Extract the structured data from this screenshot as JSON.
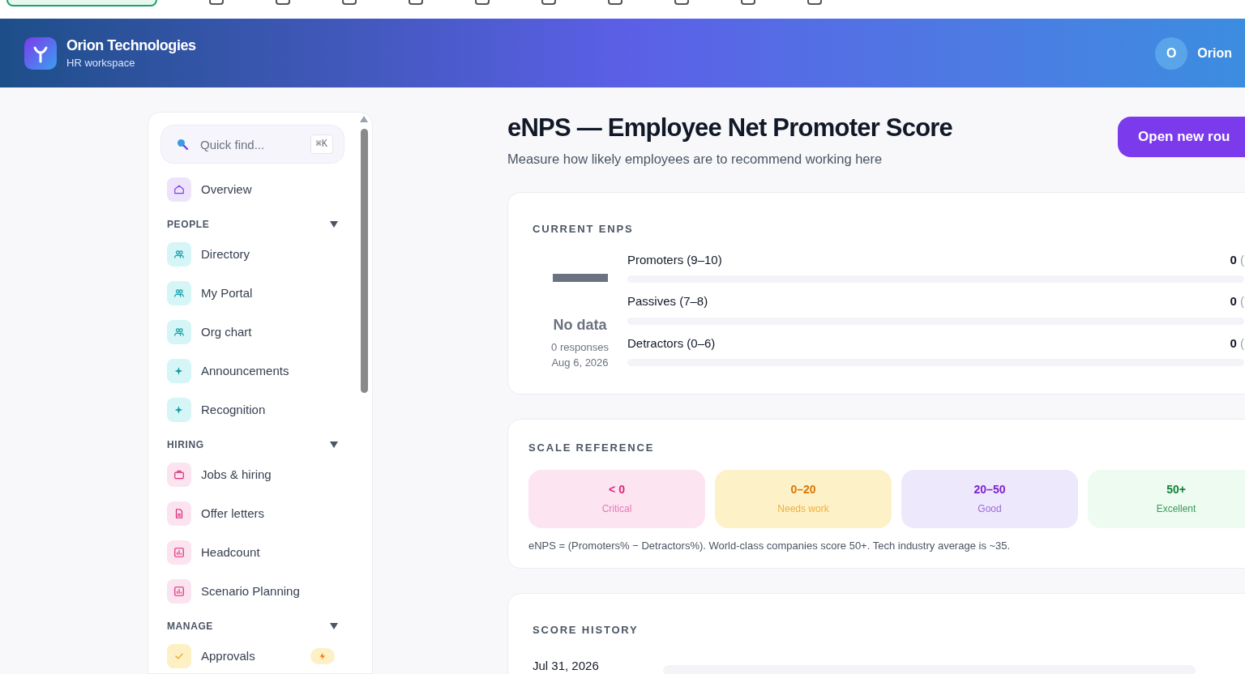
{
  "header": {
    "org": "Orion Technologies",
    "subtitle": "HR workspace",
    "avatar": "O",
    "user": "Orion"
  },
  "sidebar": {
    "search": {
      "placeholder": "Quick find...",
      "shortcut": "⌘K"
    },
    "top_items": [
      {
        "label": "Overview",
        "kind": "home",
        "color": "#ede4fb"
      }
    ],
    "sections": [
      {
        "title": "PEOPLE",
        "expanded": true,
        "items": [
          {
            "label": "Directory",
            "kind": "users",
            "color": "#d5f5f6"
          },
          {
            "label": "My Portal",
            "kind": "users",
            "color": "#d5f5f6"
          },
          {
            "label": "Org chart",
            "kind": "users",
            "color": "#d5f5f6"
          },
          {
            "label": "Announcements",
            "kind": "sparkle",
            "color": "#d5f5f6"
          },
          {
            "label": "Recognition",
            "kind": "sparkle",
            "color": "#d5f5f6"
          }
        ]
      },
      {
        "title": "HIRING",
        "expanded": true,
        "items": [
          {
            "label": "Jobs & hiring",
            "kind": "briefcase",
            "color": "#fbe3ef"
          },
          {
            "label": "Offer letters",
            "kind": "file",
            "color": "#fbe3ef"
          },
          {
            "label": "Headcount",
            "kind": "chart",
            "color": "#fbe3ef"
          },
          {
            "label": "Scenario Planning",
            "kind": "chart",
            "color": "#fbe3ef"
          }
        ]
      },
      {
        "title": "MANAGE",
        "expanded": true,
        "items": [
          {
            "label": "Approvals",
            "kind": "check",
            "color": "#fdf0c4",
            "alert": true
          }
        ]
      }
    ]
  },
  "page": {
    "title": "eNPS — Employee Net Promoter Score",
    "subtitle": "Measure how likely employees are to recommend working here",
    "action": "Open new rou"
  },
  "current": {
    "heading": "CURRENT ENPS",
    "score": "No data",
    "responses": "0 responses",
    "date": "Aug 6, 2026",
    "groups": [
      {
        "label": "Promoters (9–10)",
        "count": "0",
        "share": "(",
        "level": 0
      },
      {
        "label": "Passives (7–8)",
        "count": "0",
        "share": "(",
        "level": 0
      },
      {
        "label": "Detractors (0–6)",
        "count": "0",
        "share": "(",
        "level": 0
      }
    ]
  },
  "scale": {
    "heading": "SCALE REFERENCE",
    "bands": [
      {
        "range": "< 0",
        "label": "Critical",
        "color": "#db2777"
      },
      {
        "range": "0–20",
        "label": "Needs work",
        "color": "#d97706"
      },
      {
        "range": "20–50",
        "label": "Good",
        "color": "#7e22ce"
      },
      {
        "range": "50+",
        "label": "Excellent",
        "color": "#15803d"
      }
    ],
    "note": "eNPS = (Promoters% − Detractors%). World-class companies score 50+. Tech industry average is ~35."
  },
  "history": {
    "heading": "SCORE HISTORY",
    "entries": [
      {
        "date": "Jul 31, 2026",
        "level": 0
      }
    ]
  }
}
